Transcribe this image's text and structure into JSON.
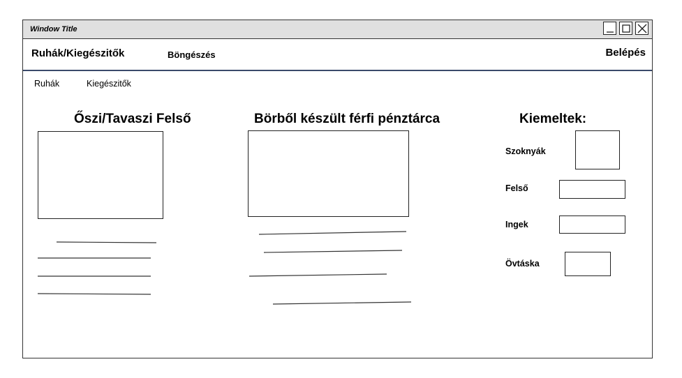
{
  "window": {
    "title": "Window Title"
  },
  "nav": {
    "brand": "Ruhák/Kiegészitők",
    "browse": "Böngészés",
    "login": "Belépés"
  },
  "subnav": [
    "Ruhák",
    "Kiegészitők"
  ],
  "products": [
    {
      "title": "Őszi/Tavaszi Felső"
    },
    {
      "title": "Börből készült férfi pénztárca"
    }
  ],
  "featured": {
    "heading": "Kiemeltek:",
    "items": [
      "Szoknyák",
      "Felső",
      "Ingek",
      "Övtáska"
    ]
  }
}
